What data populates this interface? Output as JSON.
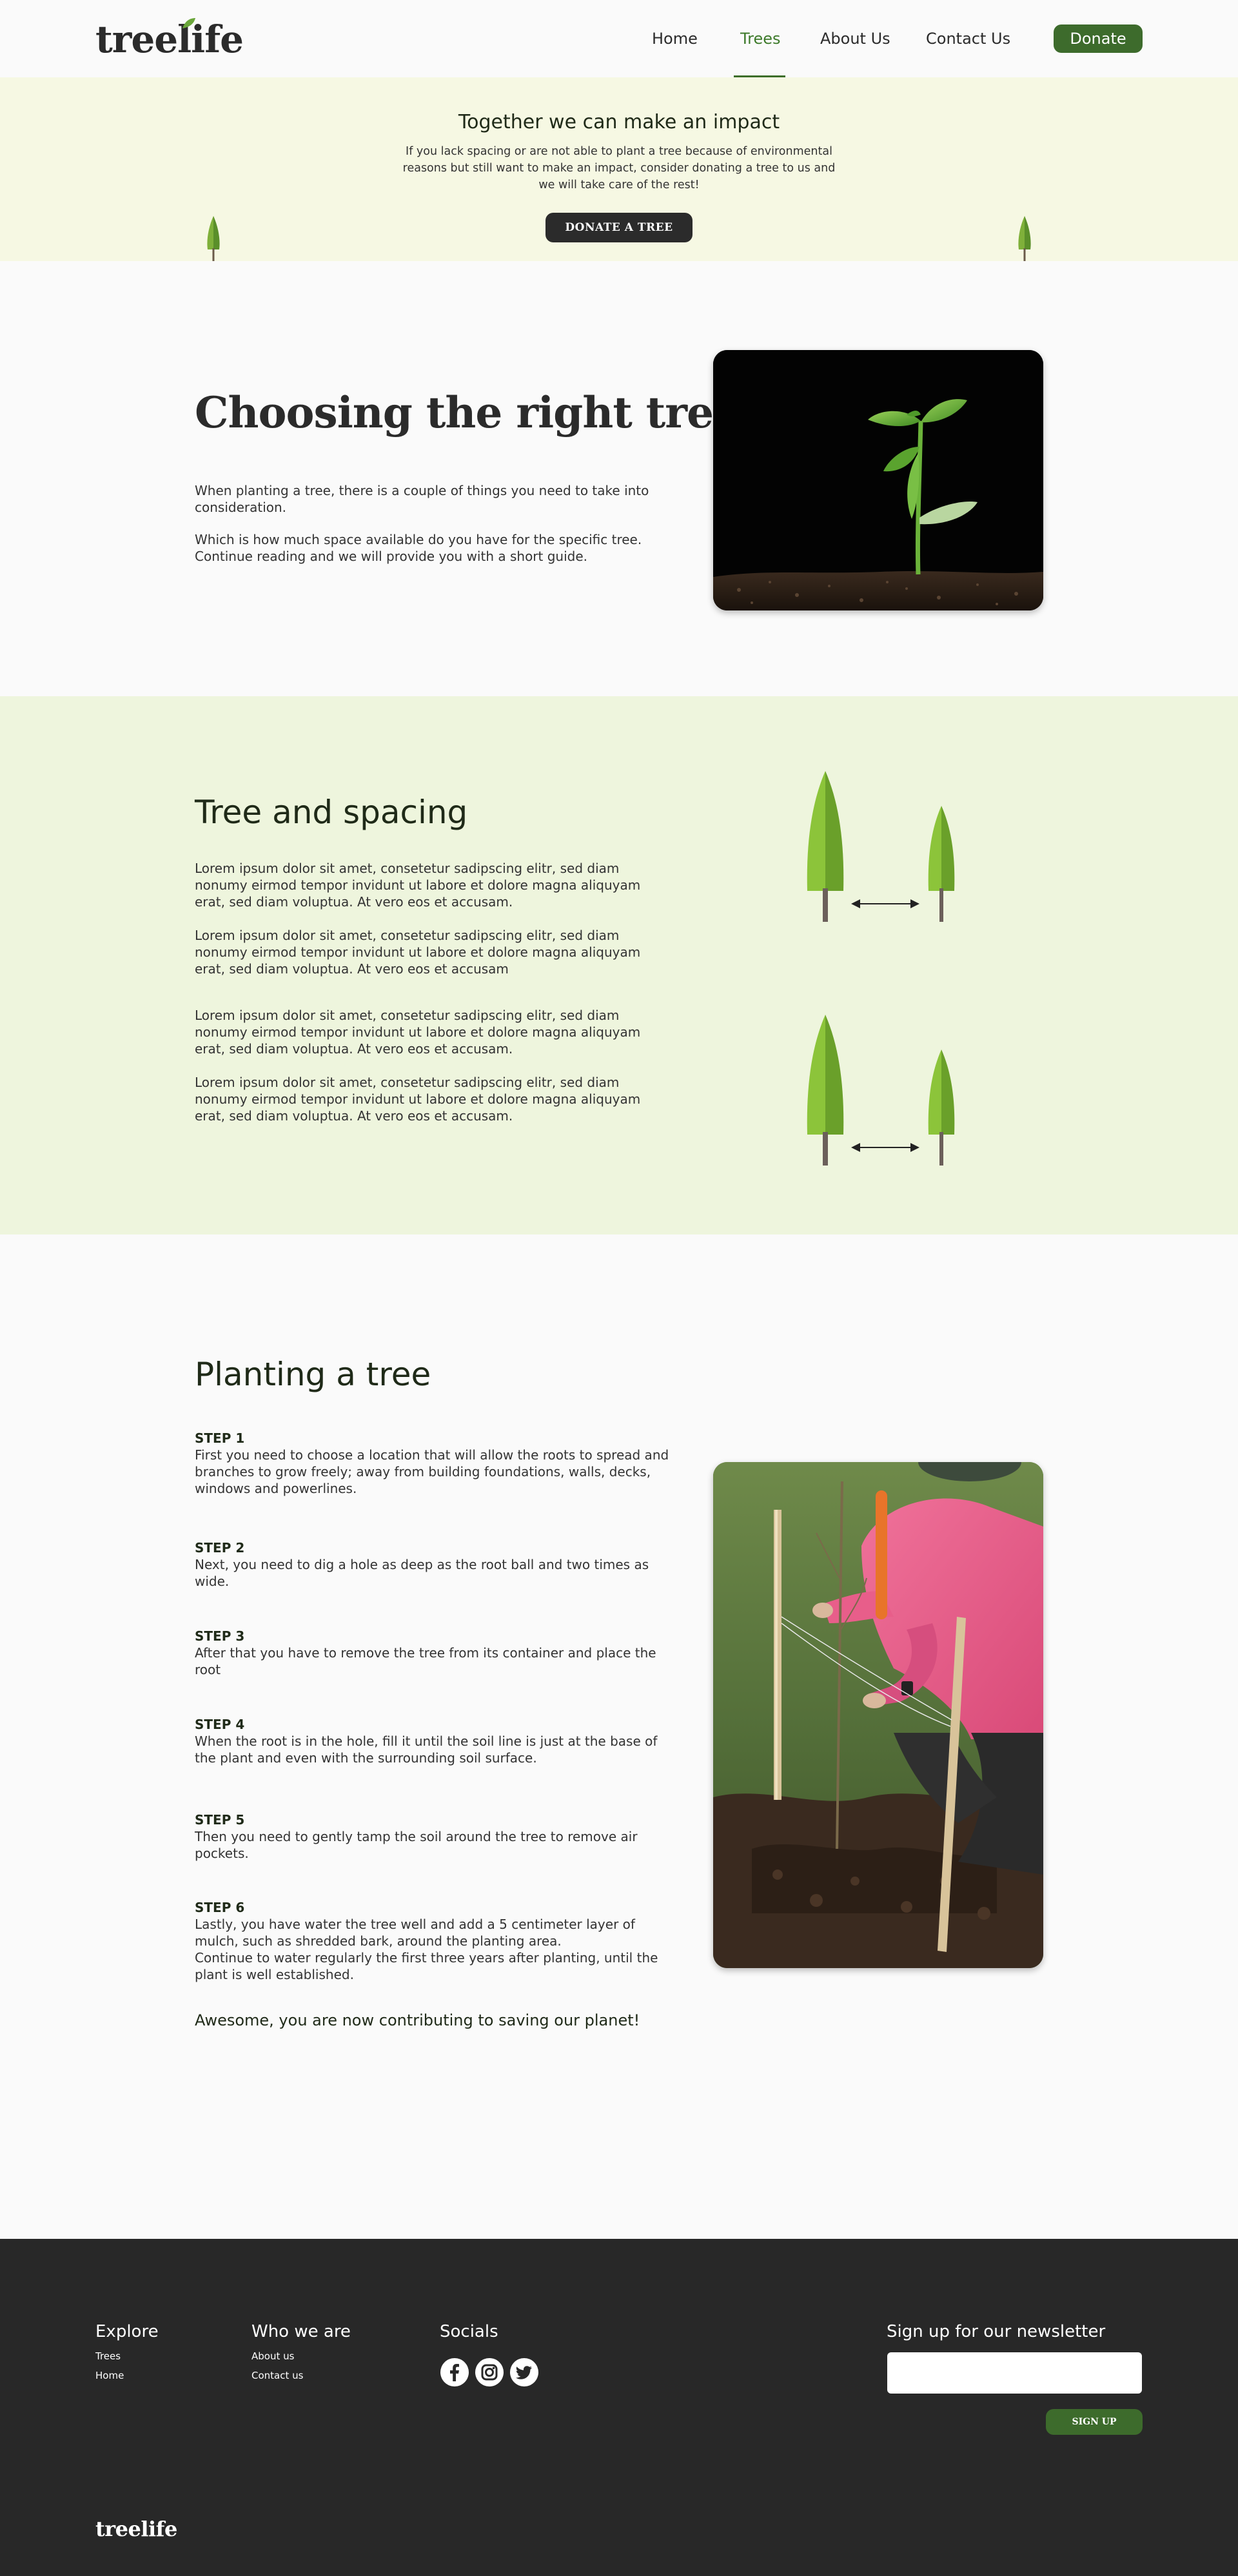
{
  "header": {
    "logo": "treelife",
    "nav": [
      "Home",
      "Trees",
      "About Us",
      "Contact Us"
    ],
    "active_nav": "Trees",
    "donate_label": "Donate"
  },
  "impact": {
    "title": "Together we can make an impact",
    "text": "If you lack spacing or are not able to plant a tree because of environmental reasons but still want to make an impact, consider donating a tree to us and we will take care of the rest!",
    "button": "DONATE A TREE"
  },
  "choosing": {
    "title": "Choosing the right tree",
    "p1": "When planting a tree, there is a couple of things you need to take into consideration.",
    "p2": "Which is how much space available do you have for the specific tree. Continue reading and we will provide you with a short guide."
  },
  "spacing": {
    "title": "Tree and spacing",
    "paragraphs": [
      "Lorem ipsum dolor sit amet, consetetur sadipscing elitr, sed diam nonumy eirmod tempor invidunt ut labore et dolore magna aliquyam erat, sed diam voluptua. At vero eos et accusam.",
      "Lorem ipsum dolor sit amet, consetetur sadipscing elitr, sed diam nonumy eirmod tempor invidunt ut labore et dolore magna aliquyam erat, sed diam voluptua. At vero eos et accusam",
      "Lorem ipsum dolor sit amet, consetetur sadipscing elitr, sed diam nonumy eirmod tempor invidunt ut labore et dolore magna aliquyam erat, sed diam voluptua. At vero eos et accusam.",
      "Lorem ipsum dolor sit amet, consetetur sadipscing elitr, sed diam nonumy eirmod tempor invidunt ut labore et dolore magna aliquyam erat, sed diam voluptua. At vero eos et accusam."
    ]
  },
  "planting": {
    "title": "Planting a tree",
    "steps": [
      {
        "label": "STEP 1",
        "text": "First you need to choose a location that will allow the roots to spread and branches to grow freely; away from building foundations, walls, decks, windows and powerlines."
      },
      {
        "label": "STEP 2",
        "text": "Next, you need to dig a hole as deep as the root ball and two times as wide."
      },
      {
        "label": "STEP 3",
        "text": "After that you have to remove the tree from its container and place the root"
      },
      {
        "label": "STEP 4",
        "text": "When the root is in the hole, fill it until the soil line is just at the base of the plant and even with the surrounding soil surface."
      },
      {
        "label": "STEP 5",
        "text": "Then you need to gently tamp the soil around the tree to remove air pockets."
      },
      {
        "label": "STEP 6",
        "text": "Lastly, you have water the tree well and add a 5 centimeter layer of mulch, such as shredded bark, around the planting area.",
        "text2": "Continue to water regularly the first three years after planting, until the plant is well established."
      }
    ],
    "closing": "Awesome, you are now contributing to saving our planet!"
  },
  "footer": {
    "explore": {
      "title": "Explore",
      "links": [
        "Trees",
        "Home"
      ]
    },
    "who": {
      "title": "Who we are",
      "links": [
        "About us",
        "Contact us"
      ]
    },
    "socials": {
      "title": "Socials",
      "icons": [
        "facebook-icon",
        "instagram-icon",
        "twitter-icon"
      ]
    },
    "newsletter": {
      "title": "Sign up for our newsletter",
      "placeholder": "",
      "button": "SIGN UP"
    },
    "logo": "treelife"
  },
  "colors": {
    "accent_green": "#3d6b2c",
    "banner_yellow": "#f6f8e3",
    "section_green": "#eef5dd",
    "footer_dark": "#282828"
  }
}
